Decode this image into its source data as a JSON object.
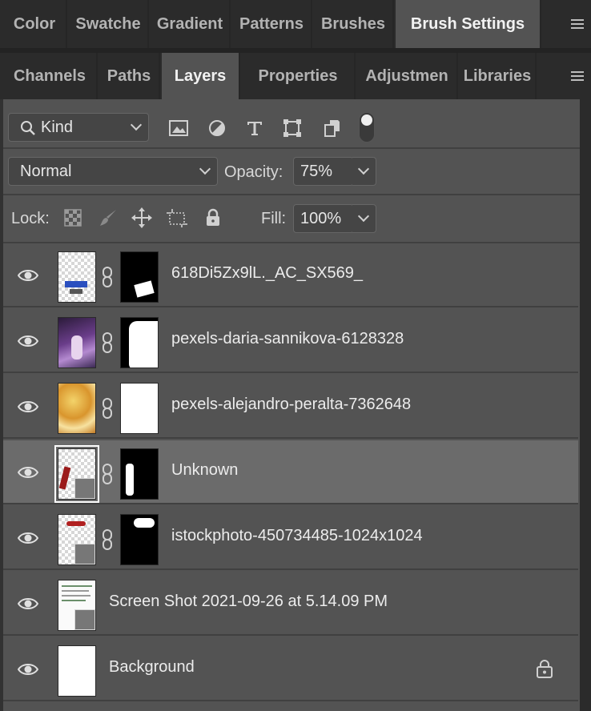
{
  "top_tabs": [
    {
      "label": "Color"
    },
    {
      "label": "Swatche"
    },
    {
      "label": "Gradient"
    },
    {
      "label": "Patterns"
    },
    {
      "label": "Brushes"
    },
    {
      "label": "Brush Settings"
    }
  ],
  "second_tabs": [
    {
      "label": "Channels"
    },
    {
      "label": "Paths"
    },
    {
      "label": "Layers"
    },
    {
      "label": "Properties"
    },
    {
      "label": "Adjustmen"
    },
    {
      "label": "Libraries"
    }
  ],
  "filter": {
    "kind_label": "Kind"
  },
  "blend_mode": "Normal",
  "opacity": {
    "label": "Opacity:",
    "value": "75%"
  },
  "lock": {
    "label": "Lock:"
  },
  "fill": {
    "label": "Fill:",
    "value": "100%"
  },
  "layers": [
    {
      "name": "618Di5Zx9lL._AC_SX569_",
      "selected": false
    },
    {
      "name": "pexels-daria-sannikova-6128328",
      "selected": false
    },
    {
      "name": "pexels-alejandro-peralta-7362648",
      "selected": false
    },
    {
      "name": "Unknown",
      "selected": true
    },
    {
      "name": "istockphoto-450734485-1024x1024",
      "selected": false
    },
    {
      "name": "Screen Shot 2021-09-26 at 5.14.09 PM",
      "selected": false
    },
    {
      "name": "Background",
      "selected": false
    }
  ],
  "colors": {
    "panel": "#535353",
    "selected_row": "#6b6b6b",
    "tabbar": "#2b2b2b"
  }
}
